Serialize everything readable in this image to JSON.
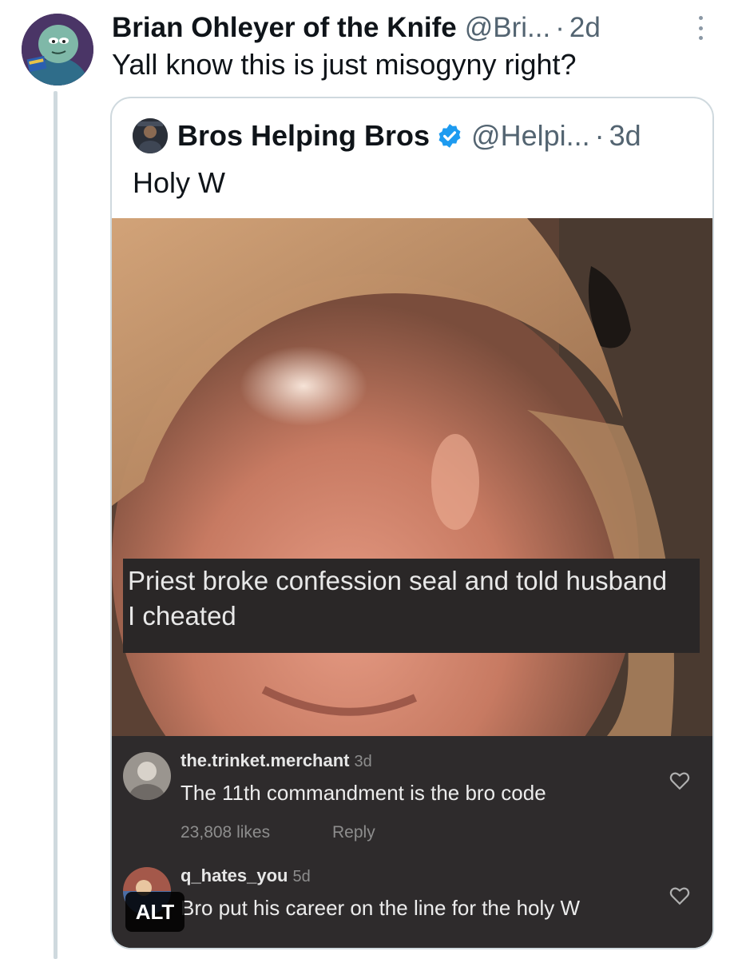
{
  "tweet": {
    "author_name": "Brian Ohleyer of the Knife",
    "handle": "@Bri...",
    "separator": "·",
    "time": "2d",
    "text": "Yall know this is just misogyny right?"
  },
  "quoted_tweet": {
    "author_name": "Bros Helping Bros",
    "handle": "@Helpi...",
    "separator": "·",
    "time": "3d",
    "text": "Holy W",
    "media": {
      "caption": "Priest broke confession seal and told husband I cheated",
      "comments": [
        {
          "username": "the.trinket.merchant",
          "age": "3d",
          "text": "The 11th commandment is the bro code",
          "likes": "23,808 likes",
          "reply_label": "Reply"
        },
        {
          "username": "q_hates_you",
          "age": "5d",
          "text": "Bro put his career on the line for the holy W"
        }
      ],
      "alt_label": "ALT"
    }
  },
  "icons": {
    "more": "more-vertical-icon",
    "verified": "verified-badge-icon",
    "heart": "heart-icon"
  },
  "colors": {
    "verified_blue": "#1d9bf0",
    "secondary_text": "#536471",
    "thread_line": "#cfd9de"
  }
}
